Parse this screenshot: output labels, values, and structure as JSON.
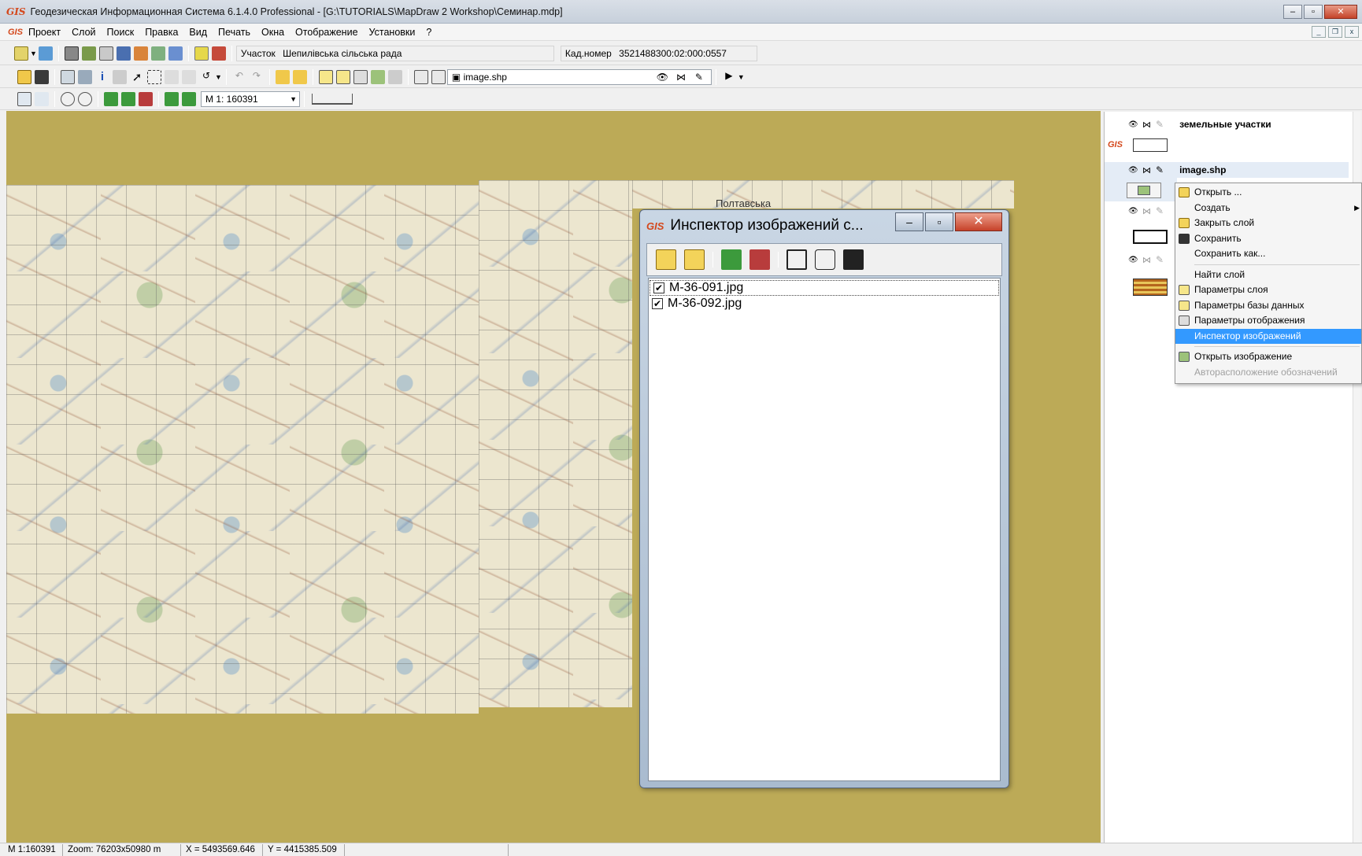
{
  "window": {
    "title": "Геодезическая Информационная Система 6.1.4.0 Professional - [G:\\TUTORIALS\\MapDraw 2 Workshop\\Семинар.mdp]",
    "app_badge": "GIS"
  },
  "menu": {
    "items": [
      "Проект",
      "Слой",
      "Поиск",
      "Правка",
      "Вид",
      "Печать",
      "Окна",
      "Отображение",
      "Установки",
      "?"
    ]
  },
  "toolbar1": {
    "plot_label": "Участок",
    "plot_value": "Шепилівська сільська рада",
    "cadastral_label": "Кад.номер",
    "cadastral_value": "3521488300:02:000:0557"
  },
  "toolbar2": {
    "active_layer": "image.shp"
  },
  "toolbar3": {
    "scale_value": "М 1: 160391"
  },
  "map": {
    "label": "Полтавська"
  },
  "image_inspector": {
    "title": "Инспектор изображений с...",
    "files": [
      {
        "name": "M-36-091.jpg",
        "checked": true
      },
      {
        "name": "M-36-092.jpg",
        "checked": true
      }
    ]
  },
  "layers_panel": {
    "layers": [
      {
        "name": "земельные участки"
      },
      {
        "name": "image.shp"
      }
    ]
  },
  "context_menu": {
    "items": [
      {
        "label": "Открыть ...",
        "icon": "open-icon"
      },
      {
        "label": "Создать",
        "icon": "",
        "submenu": true
      },
      {
        "label": "Закрыть слой",
        "icon": "close-layer-icon"
      },
      {
        "label": "Сохранить",
        "icon": "save-icon"
      },
      {
        "label": "Сохранить как...",
        "icon": ""
      },
      {
        "label": "Найти слой",
        "icon": ""
      },
      {
        "label": "Параметры слоя",
        "icon": "layer-params-icon"
      },
      {
        "label": "Параметры базы данных",
        "icon": "db-params-icon"
      },
      {
        "label": "Параметры отображения",
        "icon": "display-params-icon"
      },
      {
        "label": "Инспектор изображений",
        "icon": "",
        "highlighted": true
      },
      {
        "label": "Открыть изображение",
        "icon": "open-image-icon"
      },
      {
        "label": "Авторасположение обозначений",
        "icon": "",
        "disabled": true
      }
    ]
  },
  "status": {
    "scale": "М 1:160391",
    "zoom": "Zoom: 76203x50980 m",
    "x": "X = 5493569.646",
    "y": "Y = 4415385.509"
  },
  "colors": {
    "map_background": "#bcaa57",
    "highlight": "#3399ff",
    "close_button": "#c6422a"
  }
}
